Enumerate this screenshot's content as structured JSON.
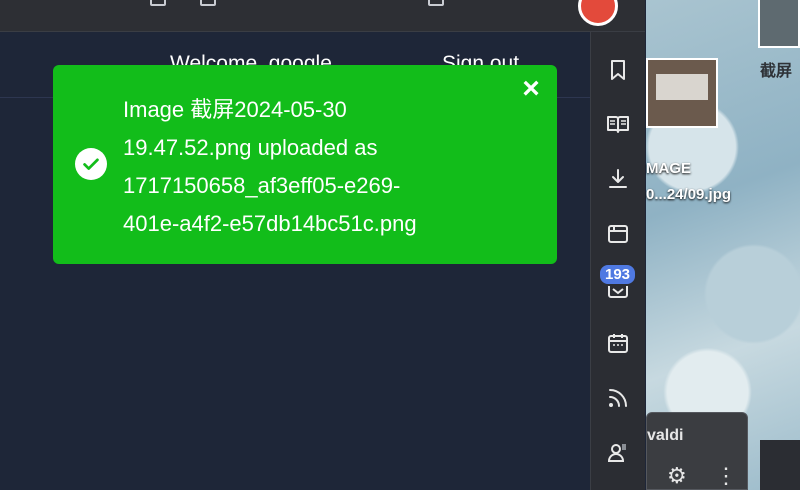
{
  "header": {
    "welcome": "Welcome, google",
    "signout": "Sign out"
  },
  "toast": {
    "lines": [
      "Image 截屏2024-05-30",
      "19.47.52.png uploaded as",
      "1717150658_af3eff05-e269-",
      "401e-a4f2-e57db14bc51c.png"
    ],
    "status_icon": "check-circle-icon",
    "close_icon": "close-icon",
    "color": "#12bd1a"
  },
  "panelbar": {
    "items": [
      {
        "icon": "bookmark-icon"
      },
      {
        "icon": "reading-list-icon"
      },
      {
        "icon": "download-icon"
      },
      {
        "icon": "window-icon"
      },
      {
        "icon": "mail-icon"
      },
      {
        "icon": "calendar-icon"
      },
      {
        "icon": "feed-icon"
      },
      {
        "icon": "contacts-icon"
      }
    ],
    "mail_badge": "193"
  },
  "desktop": {
    "label1": "MAGE",
    "label2": "0...24/09.jpg",
    "label3": "截屏"
  },
  "dock": {
    "title": "valdi"
  }
}
